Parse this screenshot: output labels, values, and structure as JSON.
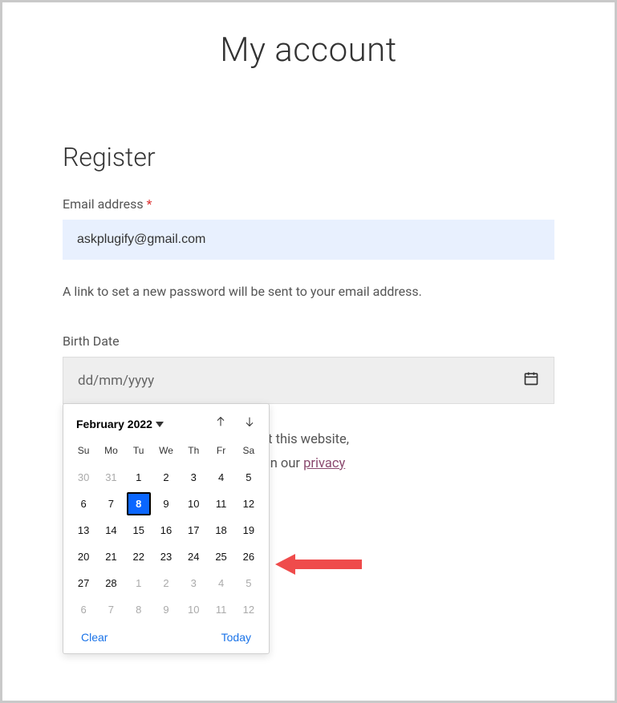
{
  "page": {
    "title": "My account"
  },
  "register": {
    "heading": "Register",
    "email_label": "Email address",
    "required_mark": "*",
    "email_value": "askplugify@gmail.com",
    "hint": "A link to set a new password will be sent to your email address.",
    "birth_label": "Birth Date",
    "birth_placeholder": "dd/mm/yyyy",
    "body_part1": " support your experience throughout this website,",
    "body_part2": ", and for other purposes described in our ",
    "privacy_label": "privacy"
  },
  "datepicker": {
    "month_label": "February 2022",
    "days_of_week": [
      "Su",
      "Mo",
      "Tu",
      "We",
      "Th",
      "Fr",
      "Sa"
    ],
    "clear_label": "Clear",
    "today_label": "Today",
    "selected_day": 8,
    "grid": [
      {
        "n": 30,
        "out": true
      },
      {
        "n": 31,
        "out": true
      },
      {
        "n": 1
      },
      {
        "n": 2
      },
      {
        "n": 3
      },
      {
        "n": 4
      },
      {
        "n": 5
      },
      {
        "n": 6
      },
      {
        "n": 7
      },
      {
        "n": 8,
        "sel": true
      },
      {
        "n": 9
      },
      {
        "n": 10
      },
      {
        "n": 11
      },
      {
        "n": 12
      },
      {
        "n": 13
      },
      {
        "n": 14
      },
      {
        "n": 15
      },
      {
        "n": 16
      },
      {
        "n": 17
      },
      {
        "n": 18
      },
      {
        "n": 19
      },
      {
        "n": 20
      },
      {
        "n": 21
      },
      {
        "n": 22
      },
      {
        "n": 23
      },
      {
        "n": 24
      },
      {
        "n": 25
      },
      {
        "n": 26
      },
      {
        "n": 27
      },
      {
        "n": 28
      },
      {
        "n": 1,
        "out": true
      },
      {
        "n": 2,
        "out": true
      },
      {
        "n": 3,
        "out": true
      },
      {
        "n": 4,
        "out": true
      },
      {
        "n": 5,
        "out": true
      },
      {
        "n": 6,
        "out": true
      },
      {
        "n": 7,
        "out": true
      },
      {
        "n": 8,
        "out": true
      },
      {
        "n": 9,
        "out": true
      },
      {
        "n": 10,
        "out": true
      },
      {
        "n": 11,
        "out": true
      },
      {
        "n": 12,
        "out": true
      }
    ]
  }
}
